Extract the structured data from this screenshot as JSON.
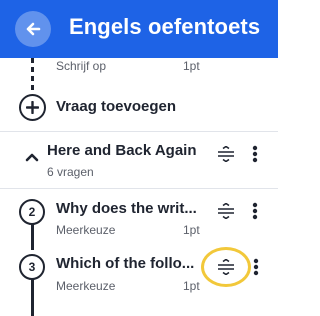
{
  "header": {
    "title": "Engels oefentoets",
    "back_icon": "arrow-left-icon",
    "background": "#1e63e6"
  },
  "previous_item": {
    "type_label": "Schrijf op",
    "points": "1pt"
  },
  "add_question": {
    "label": "Vraag toevoegen",
    "icon": "plus-circle-icon"
  },
  "section": {
    "title": "Here and Back Again",
    "count": "6 vragen",
    "expanded": true
  },
  "questions": [
    {
      "number": "2",
      "title": "Why does the writ...",
      "type_label": "Meerkeuze",
      "points": "1pt"
    },
    {
      "number": "3",
      "title": "Which of the follo...",
      "type_label": "Meerkeuze",
      "points": "1pt"
    }
  ],
  "icons": {
    "drag": "drag-handle-icon",
    "menu": "more-vertical-icon",
    "collapse": "chevron-up-icon"
  },
  "colors": {
    "accent": "#1e63e6",
    "text": "#1f2430",
    "muted": "#5c606a",
    "highlight": "#f2c83a"
  }
}
